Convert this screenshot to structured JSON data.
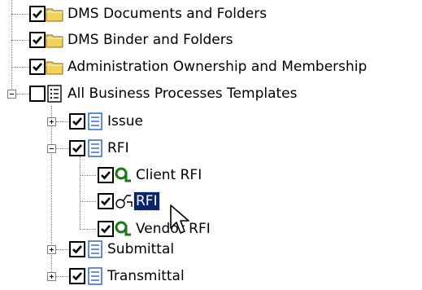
{
  "tree": {
    "nodes": [
      {
        "id": "dms-docs",
        "label": "DMS Documents and Folders",
        "checked": true,
        "icon": "folder-icon"
      },
      {
        "id": "dms-binder",
        "label": "DMS Binder and Folders",
        "checked": true,
        "icon": "folder-icon"
      },
      {
        "id": "admin",
        "label": "Administration Ownership and Membership",
        "checked": true,
        "icon": "folder-icon"
      },
      {
        "id": "all-bp",
        "label": "All Business Processes Templates",
        "checked": false,
        "icon": "template-list-icon",
        "expanded": true
      },
      {
        "id": "issue",
        "label": "Issue",
        "checked": true,
        "icon": "template-list-icon",
        "expanded": false
      },
      {
        "id": "rfi-parent",
        "label": "RFI",
        "checked": true,
        "icon": "template-list-icon",
        "expanded": true
      },
      {
        "id": "client-rfi",
        "label": "Client RFI",
        "checked": true,
        "icon": "process-icon"
      },
      {
        "id": "rfi-child",
        "label": "RFI",
        "checked": true,
        "icon": "process-outline-icon",
        "selected": true
      },
      {
        "id": "vendor-rfi",
        "label": "Vendor RFI",
        "checked": true,
        "icon": "process-icon"
      },
      {
        "id": "submittal",
        "label": "Submittal",
        "checked": true,
        "icon": "template-list-icon",
        "expanded": false
      },
      {
        "id": "transmittal",
        "label": "Transmittal",
        "checked": true,
        "icon": "template-list-icon",
        "expanded": false
      }
    ]
  },
  "colors": {
    "selection_bg": "#0a246a",
    "folder": "#f2d25c",
    "template_icon": "#3a6fd8",
    "process_icon": "#1a7a1a"
  }
}
